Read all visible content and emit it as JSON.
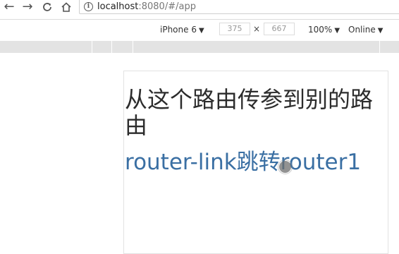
{
  "browser": {
    "back_icon": "arrow-left-icon",
    "forward_icon": "arrow-right-icon",
    "reload_icon": "reload-icon",
    "home_icon": "home-icon",
    "info_icon": "info-icon",
    "url_host": "localhost",
    "url_rest": ":8080/#/app"
  },
  "device_toolbar": {
    "device": "iPhone 6",
    "width": "375",
    "times": "×",
    "height": "667",
    "zoom": "100%",
    "throttle": "Online",
    "dropdown_icon": "triangle-down-icon"
  },
  "page": {
    "heading": "从这个路由传参到别的路由",
    "link_text": "router-link跳转router1",
    "link_color": "#3a6fa3",
    "heading_color": "#2c2c2c"
  }
}
